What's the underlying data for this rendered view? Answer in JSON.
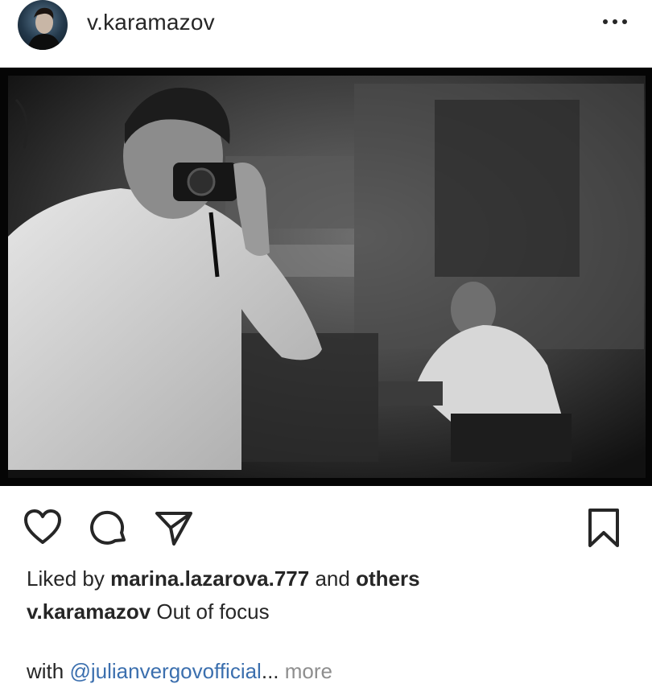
{
  "post": {
    "username": "v.karamazov"
  },
  "likes": {
    "prefix": "Liked by ",
    "liker": "marina.lazarova.777",
    "middle": " and ",
    "others": "others"
  },
  "caption": {
    "username": "v.karamazov",
    "text": " Out of focus"
  },
  "with_line": {
    "prefix": "with ",
    "mention": "@julianvergovofficial",
    "ellipsis": "...",
    "more": " more"
  },
  "icons": {
    "avatar": "profile-avatar",
    "options": "more-options-icon",
    "like": "heart-icon",
    "comment": "comment-icon",
    "share": "paper-plane-icon",
    "save": "bookmark-icon"
  },
  "colors": {
    "text": "#262626",
    "mention": "#3b6fae",
    "muted": "#8e8e8e"
  }
}
